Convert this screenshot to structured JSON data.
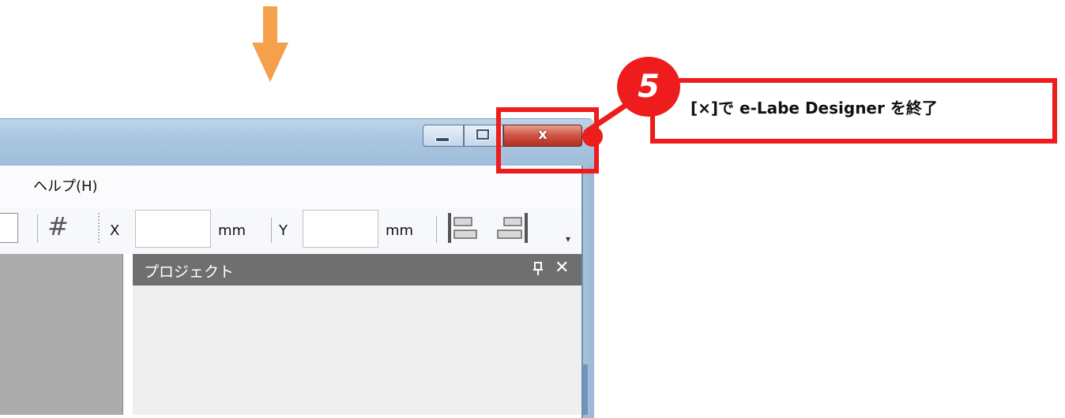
{
  "window": {
    "minimize_label": "",
    "maximize_label": "",
    "close_label": "x"
  },
  "menu": {
    "help": "ヘルプ(H)"
  },
  "toolbar": {
    "x_label": "X",
    "x_unit": "mm",
    "y_label": "Y",
    "y_unit": "mm",
    "x_value": "",
    "y_value": ""
  },
  "project_panel": {
    "title": "プロジェクト",
    "pin": "ᵖ",
    "close": "✕"
  },
  "annotation": {
    "step_number": "5",
    "text": "[×]で e-Labe Designer を終了",
    "colors": {
      "highlight": "#ee1c1c",
      "arrow": "#f5a04a"
    }
  }
}
